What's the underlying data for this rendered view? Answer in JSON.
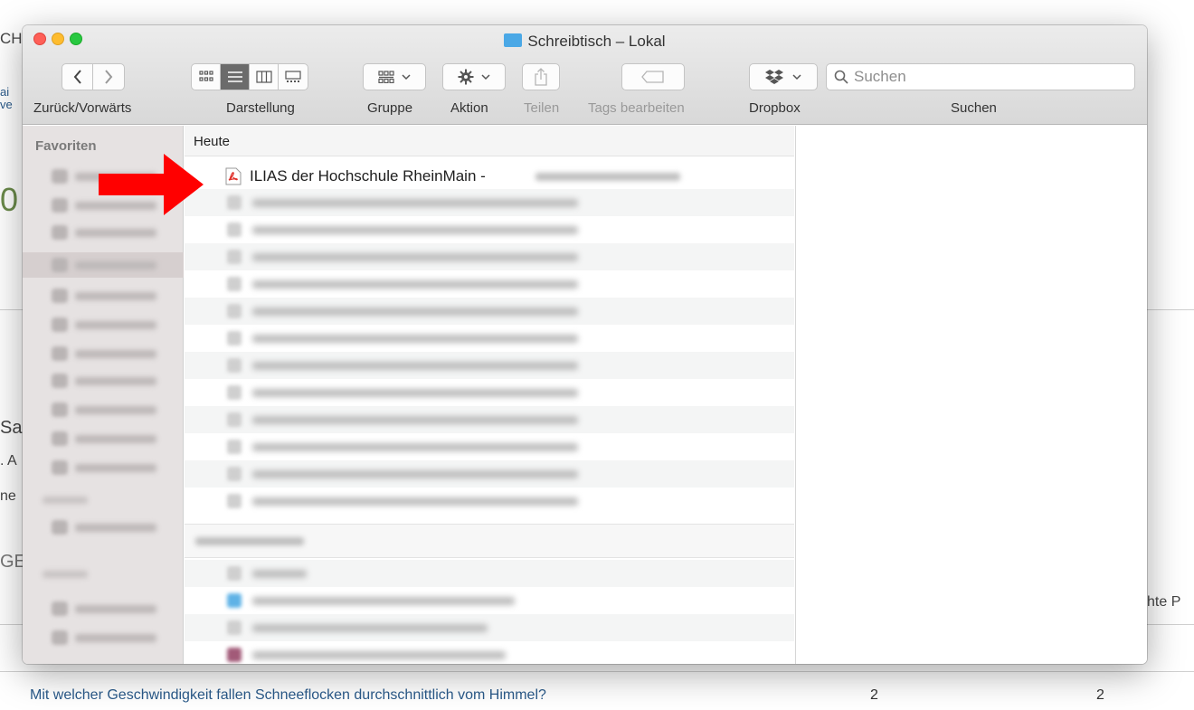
{
  "window": {
    "title": "Schreibtisch – Lokal"
  },
  "toolbar": {
    "nav_label": "Zurück/Vorwärts",
    "view_label": "Darstellung",
    "group_label": "Gruppe",
    "action_label": "Aktion",
    "share_label": "Teilen",
    "tags_label": "Tags bearbeiten",
    "dropbox_label": "Dropbox",
    "search_label": "Suchen",
    "search_placeholder": "Suchen"
  },
  "sidebar": {
    "heading": "Favoriten"
  },
  "file_list": {
    "group_today": "Heute",
    "highlighted_file": {
      "name": "ILIAS der Hochschule RheinMain -",
      "icon": "pdf-icon"
    }
  },
  "background_page": {
    "question": "Mit welcher Geschwindigkeit fallen Schneeflocken durchschnittlich vom Himmel?",
    "count_1": "2",
    "count_2": "2",
    "fragment_right": "hte P",
    "fragment_left_1": "CH",
    "fragment_left_2": "ai",
    "fragment_left_3": "ve",
    "fragment_left_4": "0",
    "fragment_left_5": "Sa",
    "fragment_left_6": ". A",
    "fragment_left_7": "ne",
    "fragment_left_8": "GE"
  },
  "colors": {
    "arrow": "#ff0000",
    "folder_accent": "#4aa8e6",
    "question_link": "#2a5a8a"
  }
}
